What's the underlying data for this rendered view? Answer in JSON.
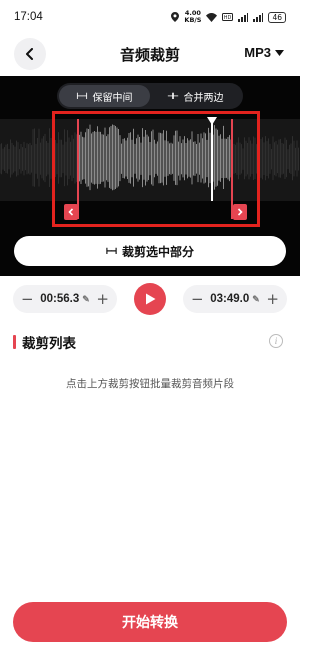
{
  "status": {
    "time": "17:04",
    "speed": "4.00\nKB/S",
    "battery": "46"
  },
  "header": {
    "title": "音频裁剪",
    "format": "MP3"
  },
  "editor": {
    "modes": [
      {
        "label": "保留中间",
        "active": true
      },
      {
        "label": "合并两边",
        "active": false
      }
    ],
    "trim_selected_label": "裁剪选中部分",
    "highlight_color": "#e3231e"
  },
  "controls": {
    "start_time": "00:56.3",
    "end_time": "03:49.0"
  },
  "list": {
    "title": "裁剪列表",
    "empty_hint": "点击上方裁剪按钮批量裁剪音频片段"
  },
  "footer": {
    "convert_label": "开始转换"
  },
  "colors": {
    "accent": "#e54551",
    "editor_bg": "#050505"
  }
}
